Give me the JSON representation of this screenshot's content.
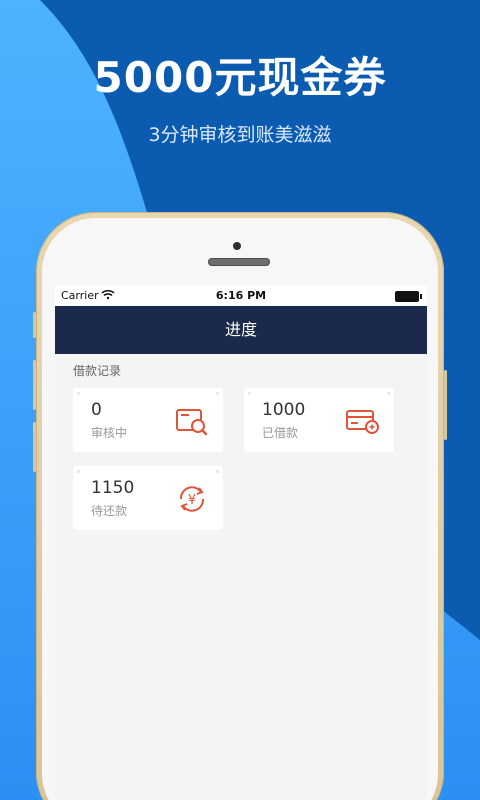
{
  "promo": {
    "title": "5000元现金券",
    "subtitle": "3分钟审核到账美滋滋"
  },
  "status_bar": {
    "carrier": "Carrier",
    "time": "6:16 PM"
  },
  "nav": {
    "title": "进度"
  },
  "section": {
    "label": "借款记录"
  },
  "cards": [
    {
      "value": "0",
      "label": "审核中",
      "icon": "search-document-icon"
    },
    {
      "value": "1000",
      "label": "已借款",
      "icon": "card-coin-icon"
    },
    {
      "value": "1150",
      "label": "待还款",
      "icon": "yuan-cycle-icon"
    }
  ],
  "colors": {
    "background_blue": "#0a5fb6",
    "light_blue": "#3aa0ff",
    "nav_bar": "#1b2a4a",
    "icon_accent": "#e0553a"
  }
}
